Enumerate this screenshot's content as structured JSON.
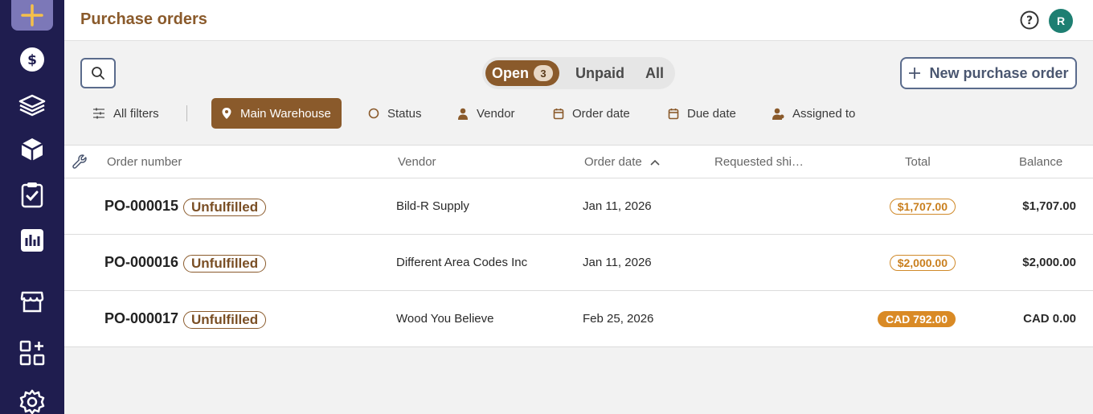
{
  "header": {
    "title": "Purchase orders",
    "avatar_initial": "R"
  },
  "sidebar": {
    "items": [
      {
        "name": "add-icon"
      },
      {
        "name": "dollar-icon"
      },
      {
        "name": "layers-icon"
      },
      {
        "name": "box-icon"
      },
      {
        "name": "clipboard-check-icon"
      },
      {
        "name": "bar-chart-icon"
      },
      {
        "name": "store-icon"
      },
      {
        "name": "apps-add-icon"
      },
      {
        "name": "gear-icon"
      }
    ]
  },
  "toolbar": {
    "tabs": {
      "open": "Open",
      "open_count": "3",
      "unpaid": "Unpaid",
      "all": "All"
    },
    "new_button": "New purchase order"
  },
  "filters": {
    "all_filters": "All filters",
    "location": "Main Warehouse",
    "status": "Status",
    "vendor": "Vendor",
    "order_date": "Order date",
    "due_date": "Due date",
    "assigned_to": "Assigned to"
  },
  "table": {
    "columns": {
      "order_number": "Order number",
      "vendor": "Vendor",
      "order_date": "Order date",
      "requested_ship": "Requested shi…",
      "total": "Total",
      "balance": "Balance"
    },
    "rows": [
      {
        "number": "PO-000015",
        "status": "Unfulfilled",
        "vendor": "Bild-R Supply",
        "date": "Jan 11, 2026",
        "total": "$1,707.00",
        "balance": "$1,707.00"
      },
      {
        "number": "PO-000016",
        "status": "Unfulfilled",
        "vendor": "Different Area Codes Inc",
        "date": "Jan 11, 2026",
        "total": "$2,000.00",
        "balance": "$2,000.00"
      },
      {
        "number": "PO-000017",
        "status": "Unfulfilled",
        "vendor": "Wood You Believe",
        "date": "Feb 25, 2026",
        "total": "CAD 792.00",
        "balance": "CAD 0.00"
      }
    ]
  },
  "colors": {
    "brand": "#8a5a2b",
    "sidebar": "#1f1d4f",
    "accent_orange": "#d98a25",
    "avatar": "#1e7f72"
  }
}
